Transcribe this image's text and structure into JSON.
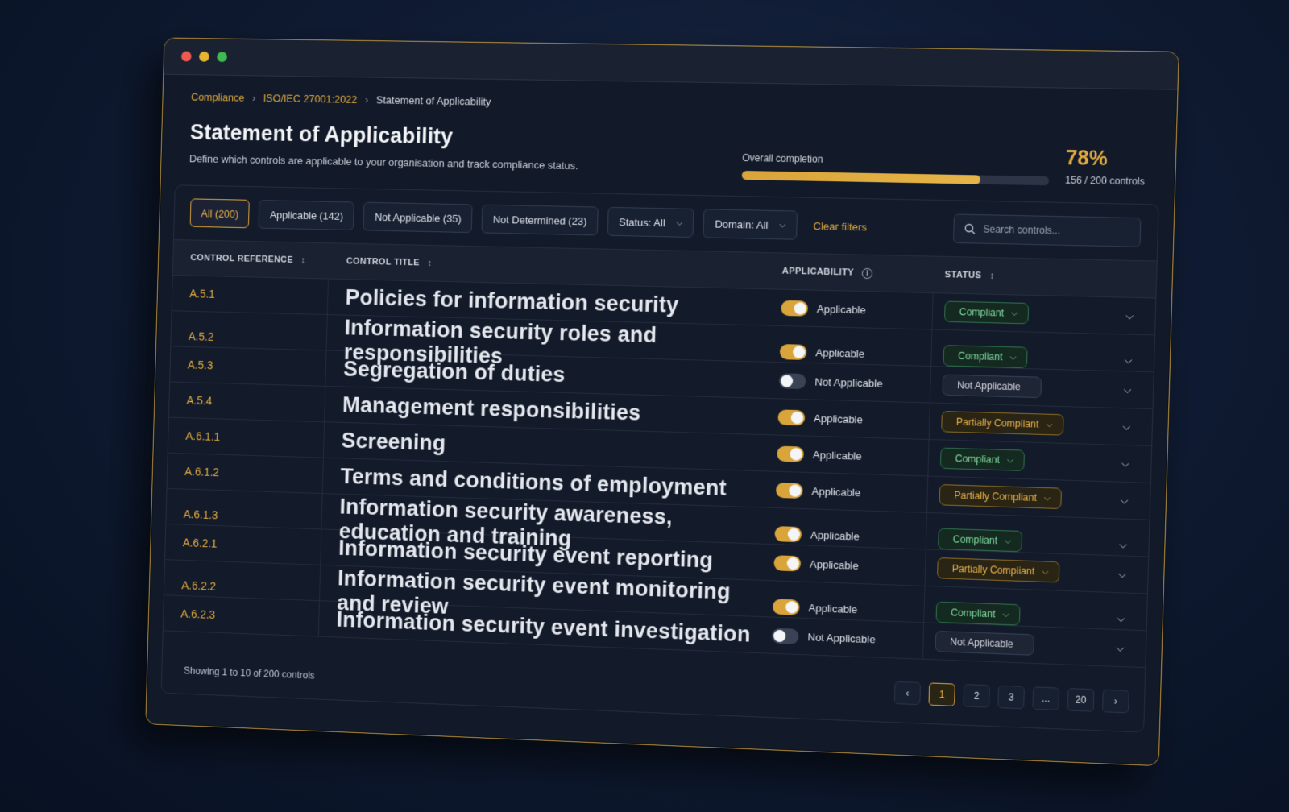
{
  "window": {
    "traffic_lights": [
      "#ee5a52",
      "#e9b52f",
      "#3fb950"
    ]
  },
  "breadcrumb": {
    "items": [
      "Compliance",
      "ISO/IEC 27001:2022"
    ],
    "current": "Statement of Applicability",
    "separator": "›"
  },
  "header": {
    "title": "Statement of Applicability",
    "subtitle": "Define which controls are applicable to your organisation and track compliance status."
  },
  "completion": {
    "label": "Overall completion",
    "percent_text": "78%",
    "progress": 0.78,
    "count_text": "156 / 200 controls"
  },
  "filters": {
    "chips": [
      "All (200)",
      "Applicable (142)",
      "Not Applicable (35)",
      "Not Determined (23)"
    ],
    "active_chip": 0,
    "status_dropdown": "Status: All",
    "domain_dropdown": "Domain: All",
    "clear": "Clear filters"
  },
  "search": {
    "placeholder": "Search controls..."
  },
  "table": {
    "headers": {
      "ref": "CONTROL REFERENCE",
      "title": "CONTROL TITLE",
      "applicability": "APPLICABILITY",
      "status": "STATUS"
    },
    "rows": [
      {
        "ref": "A.5.1",
        "title": "Policies for information security",
        "applicable": true,
        "applicability": "Applicable",
        "status": "Compliant"
      },
      {
        "ref": "A.5.2",
        "title": "Information security roles and responsibilities",
        "applicable": true,
        "applicability": "Applicable",
        "status": "Compliant"
      },
      {
        "ref": "A.5.3",
        "title": "Segregation of duties",
        "applicable": false,
        "applicability": "Not Applicable",
        "status": "Not Applicable"
      },
      {
        "ref": "A.5.4",
        "title": "Management responsibilities",
        "applicable": true,
        "applicability": "Applicable",
        "status": "Partially Compliant"
      },
      {
        "ref": "A.6.1.1",
        "title": "Screening",
        "applicable": true,
        "applicability": "Applicable",
        "status": "Compliant"
      },
      {
        "ref": "A.6.1.2",
        "title": "Terms and conditions of employment",
        "applicable": true,
        "applicability": "Applicable",
        "status": "Partially Compliant"
      },
      {
        "ref": "A.6.1.3",
        "title": "Information security awareness, education and training",
        "applicable": true,
        "applicability": "Applicable",
        "status": "Compliant"
      },
      {
        "ref": "A.6.2.1",
        "title": "Information security event reporting",
        "applicable": true,
        "applicability": "Applicable",
        "status": "Partially Compliant"
      },
      {
        "ref": "A.6.2.2",
        "title": "Information security event monitoring and review",
        "applicable": true,
        "applicability": "Applicable",
        "status": "Compliant"
      },
      {
        "ref": "A.6.2.3",
        "title": "Information security event investigation",
        "applicable": false,
        "applicability": "Not Applicable",
        "status": "Not Applicable"
      }
    ]
  },
  "footer": {
    "showing": "Showing 1 to 10 of 200 controls",
    "pages": [
      "1",
      "2",
      "3",
      "...",
      "20"
    ],
    "active_page": 0
  },
  "colors": {
    "accent": "#e0aa3e",
    "compliant": "#7fdba2",
    "partial": "#e8b24a",
    "background": "#121a29"
  }
}
